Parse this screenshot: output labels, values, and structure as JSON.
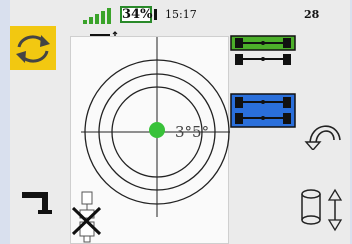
{
  "status_bar": {
    "battery_percent_label": "34%",
    "battery_level": 0.34,
    "signal_bars": 5,
    "time": "15:17",
    "counter": "28"
  },
  "target": {
    "angle_label": "3°5°"
  },
  "icons": {
    "rotate": "rotate-arrows-icon",
    "lift_top": "lift-arm-icon",
    "axle_green": "axle-green-icon",
    "axle_blue": "axle-blue-icon",
    "undo": "undo-arrow-icon",
    "lift_bottom": "lift-arm-icon",
    "sensor_disabled": "sensor-disabled-icon",
    "height_adjust": "height-adjust-icon"
  },
  "colors": {
    "rotate_bg": "#f2c811",
    "axle_green": "#4caf2a",
    "axle_blue": "#2a6fdb",
    "target_dot": "#39c23a",
    "signal": "#3aa32a"
  }
}
